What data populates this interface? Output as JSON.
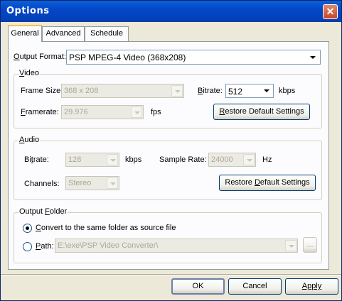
{
  "window": {
    "title": "Options",
    "close_glyph": "✕"
  },
  "tabs": [
    {
      "label": "General",
      "active": true
    },
    {
      "label": "Advanced",
      "active": false
    },
    {
      "label": "Schedule",
      "active": false
    }
  ],
  "general": {
    "output_format_label": "Output Format:",
    "output_format_value": "PSP MPEG-4 Video (368x208)",
    "video": {
      "legend": "Video",
      "frame_size_label": "Frame Size:",
      "frame_size_value": "368 x 208",
      "bitrate_label": "Bitrate:",
      "bitrate_value": "512",
      "bitrate_unit": "kbps",
      "framerate_label": "Framerate:",
      "framerate_value": "29.976",
      "framerate_unit": "fps",
      "restore_label": "Restore Default Settings"
    },
    "audio": {
      "legend": "Audio",
      "bitrate_label": "Bitrate:",
      "bitrate_value": "128",
      "bitrate_unit": "kbps",
      "sample_rate_label": "Sample Rate:",
      "sample_rate_value": "24000",
      "sample_rate_unit": "Hz",
      "channels_label": "Channels:",
      "channels_value": "Stereo",
      "restore_label": "Restore Default Settings"
    },
    "output_folder": {
      "legend": "Output Folder",
      "same_folder_label": "Convert to the same folder as source file",
      "same_folder_selected": true,
      "path_label": "Path:",
      "path_value": "E:\\exe\\PSP Video Converter\\",
      "browse_label": "..."
    }
  },
  "footer": {
    "ok_label": "OK",
    "cancel_label": "Cancel",
    "apply_label": "Apply"
  }
}
